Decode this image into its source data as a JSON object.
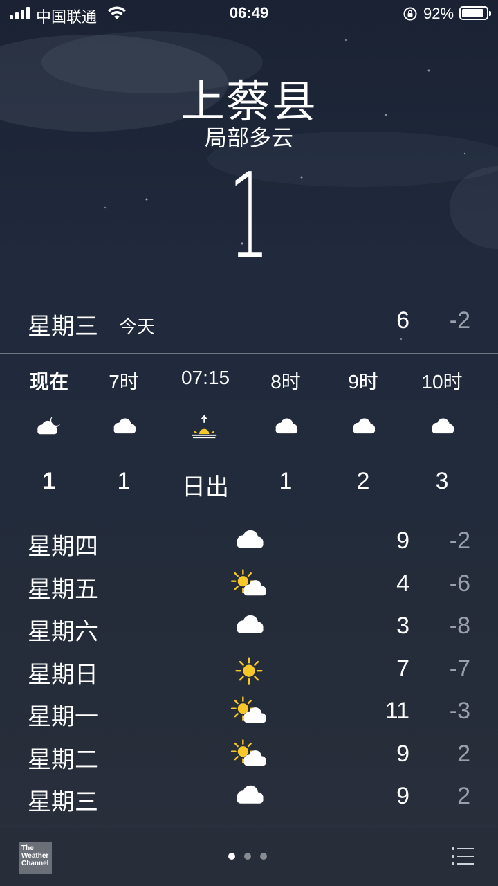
{
  "status_bar": {
    "carrier": "中国联通",
    "time": "06:49",
    "battery_percent": "92%",
    "battery_level": 0.92
  },
  "header": {
    "city": "上蔡县",
    "condition": "局部多云",
    "current_temp": "1"
  },
  "today": {
    "day": "星期三",
    "tag": "今天",
    "high": "6",
    "low": "-2"
  },
  "hourly": [
    {
      "label": "现在",
      "icon": "partly-cloudy-night-icon",
      "value": "1"
    },
    {
      "label": "7时",
      "icon": "cloud-icon",
      "value": "1"
    },
    {
      "label": "07:15",
      "icon": "sunrise-icon",
      "value": "日出"
    },
    {
      "label": "8时",
      "icon": "cloud-icon",
      "value": "1"
    },
    {
      "label": "9时",
      "icon": "cloud-icon",
      "value": "2"
    },
    {
      "label": "10时",
      "icon": "cloud-icon",
      "value": "3"
    }
  ],
  "daily": [
    {
      "day": "星期四",
      "icon": "cloud-icon",
      "high": "9",
      "low": "-2"
    },
    {
      "day": "星期五",
      "icon": "partly-sunny-icon",
      "high": "4",
      "low": "-6"
    },
    {
      "day": "星期六",
      "icon": "cloud-icon",
      "high": "3",
      "low": "-8"
    },
    {
      "day": "星期日",
      "icon": "sun-icon",
      "high": "7",
      "low": "-7"
    },
    {
      "day": "星期一",
      "icon": "partly-sunny-icon",
      "high": "11",
      "low": "-3"
    },
    {
      "day": "星期二",
      "icon": "partly-sunny-icon",
      "high": "9",
      "low": "2"
    },
    {
      "day": "星期三",
      "icon": "cloud-icon",
      "high": "9",
      "low": "2"
    }
  ],
  "footer": {
    "logo_text": [
      "The",
      "Weather",
      "Channel"
    ],
    "page_count": 3,
    "active_page": 1
  },
  "colors": {
    "sun": "#f7c928",
    "low_temp": "#9aa0ab"
  }
}
